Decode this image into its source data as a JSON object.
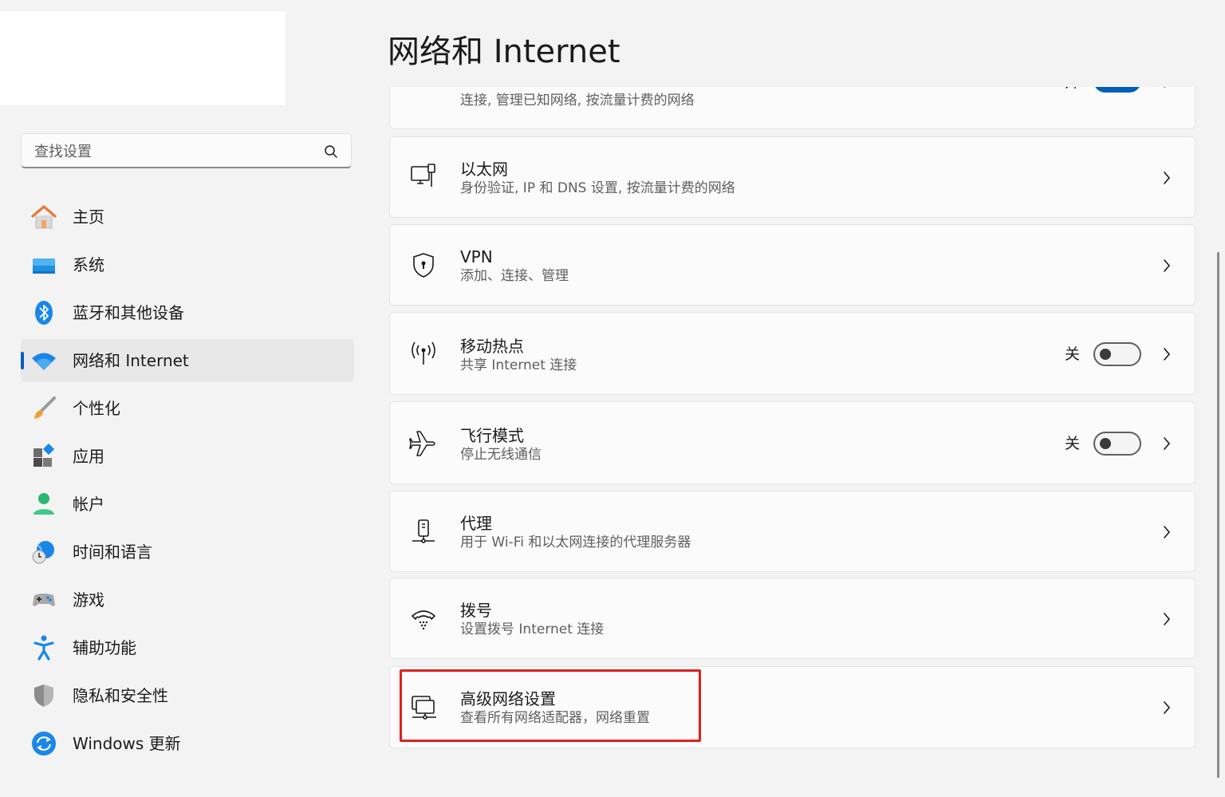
{
  "search": {
    "placeholder": "查找设置"
  },
  "sidebar": {
    "items": [
      {
        "label": "主页",
        "icon": "home-icon",
        "active": false
      },
      {
        "label": "系统",
        "icon": "system-icon",
        "active": false
      },
      {
        "label": "蓝牙和其他设备",
        "icon": "bluetooth-icon",
        "active": false
      },
      {
        "label": "网络和 Internet",
        "icon": "wifi-icon",
        "active": true
      },
      {
        "label": "个性化",
        "icon": "brush-icon",
        "active": false
      },
      {
        "label": "应用",
        "icon": "apps-icon",
        "active": false
      },
      {
        "label": "帐户",
        "icon": "account-icon",
        "active": false
      },
      {
        "label": "时间和语言",
        "icon": "time-language-icon",
        "active": false
      },
      {
        "label": "游戏",
        "icon": "gamepad-icon",
        "active": false
      },
      {
        "label": "辅助功能",
        "icon": "accessibility-icon",
        "active": false
      },
      {
        "label": "隐私和安全性",
        "icon": "shield-icon",
        "active": false
      },
      {
        "label": "Windows 更新",
        "icon": "update-icon",
        "active": false
      }
    ]
  },
  "main": {
    "title": "网络和 Internet",
    "cards": [
      {
        "title": "",
        "subtitle": "连接, 管理已知网络, 按流量计费的网络",
        "icon": "wifi-signal-icon",
        "toggle": {
          "state_label": "开",
          "on": true
        }
      },
      {
        "title": "以太网",
        "subtitle": "身份验证, IP 和 DNS 设置, 按流量计费的网络",
        "icon": "ethernet-icon"
      },
      {
        "title": "VPN",
        "subtitle": "添加、连接、管理",
        "icon": "vpn-shield-icon"
      },
      {
        "title": "移动热点",
        "subtitle": "共享 Internet 连接",
        "icon": "hotspot-icon",
        "toggle": {
          "state_label": "关",
          "on": false
        }
      },
      {
        "title": "飞行模式",
        "subtitle": "停止无线通信",
        "icon": "airplane-icon",
        "toggle": {
          "state_label": "关",
          "on": false
        }
      },
      {
        "title": "代理",
        "subtitle": "用于 Wi-Fi 和以太网连接的代理服务器",
        "icon": "proxy-icon"
      },
      {
        "title": "拨号",
        "subtitle": "设置拨号 Internet 连接",
        "icon": "dialup-icon"
      },
      {
        "title": "高级网络设置",
        "subtitle": "查看所有网络适配器，网络重置",
        "icon": "advanced-network-icon",
        "highlighted": true
      }
    ]
  },
  "colors": {
    "accent": "#005fb8",
    "highlight_box": "#e0211d",
    "background": "#f3f3f3",
    "card": "#fbfbfb"
  }
}
